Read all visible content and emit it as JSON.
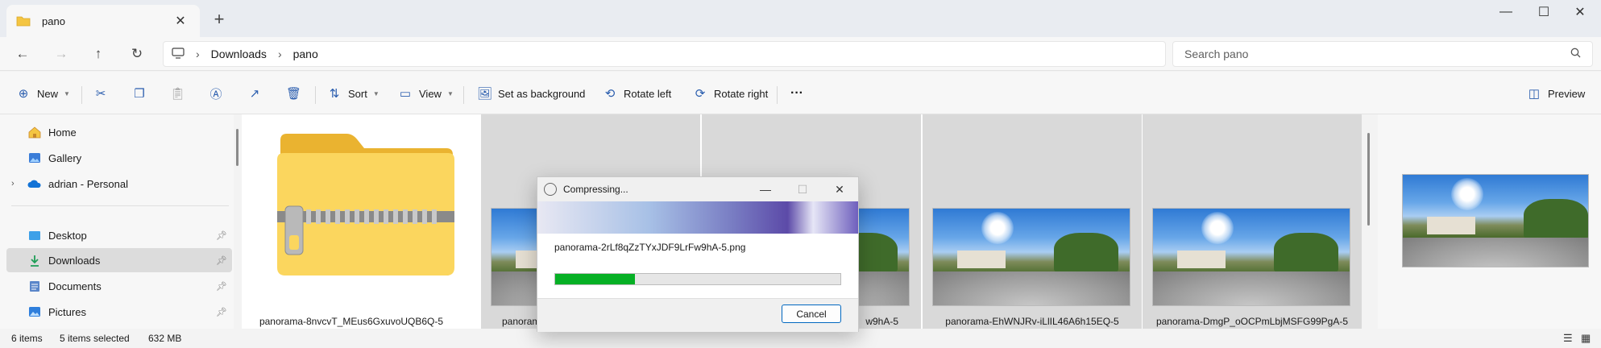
{
  "tab": {
    "title": "pano"
  },
  "window": {
    "minimize": "—",
    "maximize": "☐",
    "close": "✕"
  },
  "nav": {
    "back": "←",
    "forward": "→",
    "up": "↑",
    "refresh": "↻"
  },
  "breadcrumbs": [
    "Downloads",
    "pano"
  ],
  "search": {
    "placeholder": "Search pano"
  },
  "toolbar": {
    "new_label": "New",
    "sort_label": "Sort",
    "view_label": "View",
    "set_background_label": "Set as background",
    "rotate_left_label": "Rotate left",
    "rotate_right_label": "Rotate right",
    "more_label": "···",
    "preview_label": "Preview"
  },
  "sidebar": {
    "items": [
      {
        "label": "Home",
        "icon": "home-icon"
      },
      {
        "label": "Gallery",
        "icon": "gallery-icon"
      },
      {
        "label": "adrian - Personal",
        "icon": "cloud-icon"
      },
      {
        "label": "Desktop",
        "icon": "desktop-icon"
      },
      {
        "label": "Downloads",
        "icon": "download-icon"
      },
      {
        "label": "Documents",
        "icon": "documents-icon"
      },
      {
        "label": "Pictures",
        "icon": "pictures-icon"
      }
    ]
  },
  "files": [
    {
      "name": "panorama-8nvcvT_MEus6GxuvoUQB6Q-5"
    },
    {
      "name": "panorama-"
    },
    {
      "name": "w9hA-5"
    },
    {
      "name": "panorama-EhWNJRv-iLlIL46A6h15EQ-5"
    },
    {
      "name": "panorama-DmgP_oOCPmLbjMSFG99PgA-5"
    }
  ],
  "status": {
    "items": "6 items",
    "selected": "5 items selected",
    "size": "632 MB"
  },
  "dialog": {
    "title": "Compressing...",
    "filename": "panorama-2rLf8qZzTYxJDF9LrFw9hA-5.png",
    "progress": 0.28,
    "cancel_label": "Cancel"
  },
  "colors": {
    "accent": "#0067c0",
    "progress": "#06b025",
    "folder": "#f4c542"
  }
}
